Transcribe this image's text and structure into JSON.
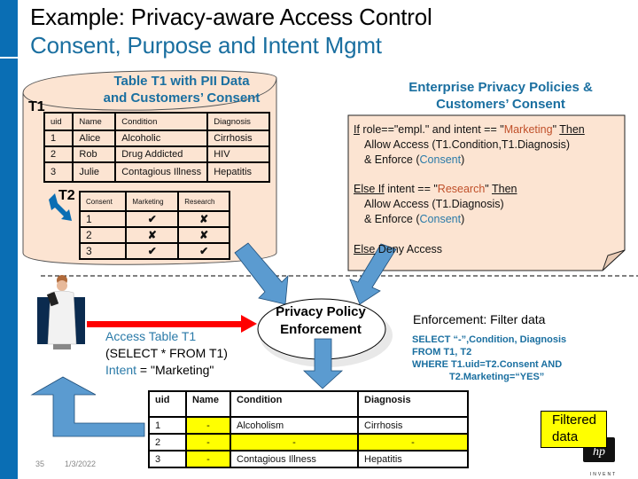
{
  "slide": {
    "title_line1": "Example: Privacy-aware Access Control",
    "title_line2": "Consent, Purpose and Intent Mgmt",
    "page_number": "35",
    "date": "1/3/2022",
    "colors": {
      "accent_blue": "#0a6eb4",
      "title_blue": "#1a6fa0",
      "arrow_blue": "#5b9bd0",
      "cylinder_fill": "#fce4d2",
      "highlight_yellow": "#ffff00",
      "red_arrow": "#ff0000"
    }
  },
  "database": {
    "title_line1": "Table T1 with PII Data",
    "title_line2": "and Customers’ Consent",
    "t1": {
      "label": "T1",
      "headers": [
        "uid",
        "Name",
        "Condition",
        "Diagnosis"
      ],
      "rows": [
        [
          "1",
          "Alice",
          "Alcoholic",
          "Cirrhosis"
        ],
        [
          "2",
          "Rob",
          "Drug Addicted",
          "HIV"
        ],
        [
          "3",
          "Julie",
          "Contagious Illness",
          "Hepatitis"
        ]
      ]
    },
    "t2": {
      "label": "T2",
      "headers": [
        "Consent",
        "Marketing",
        "Research"
      ],
      "rows": [
        {
          "consent": "1",
          "marketing": "yes",
          "research": "no"
        },
        {
          "consent": "2",
          "marketing": "no",
          "research": "no"
        },
        {
          "consent": "3",
          "marketing": "yes",
          "research": "yes"
        }
      ],
      "yes_glyph": "✔",
      "no_glyph": "✘"
    }
  },
  "policies": {
    "title_line1": "Enterprise Privacy Policies &",
    "title_line2": "Customers’ Consent",
    "rule1": {
      "kw_if": "If",
      "cond_pre": " role==\"empl.\" and intent == \"",
      "intent": "Marketing",
      "cond_post": "\" ",
      "kw_then": "Then",
      "action": "Allow Access (T1.Condition,T1.Diagnosis)",
      "enforce_pre": "& Enforce (",
      "enforce_kw": "Consent",
      "enforce_post": ")"
    },
    "rule2": {
      "kw_elseif": "Else If",
      "cond_pre": " intent == \"",
      "intent": "Research",
      "cond_post": "\" ",
      "kw_then": "Then",
      "action": "Allow Access (T1.Diagnosis)",
      "enforce_pre": "& Enforce (",
      "enforce_kw": "Consent",
      "enforce_post": ")"
    },
    "rule3": {
      "kw_else": "Else",
      "action": " Deny Access"
    }
  },
  "request": {
    "line1": "Access Table T1",
    "line2": "(SELECT * FROM T1)",
    "line3_kw": "Intent",
    "line3_rest": " = \"Marketing\""
  },
  "enforcement": {
    "node_line1": "Privacy Policy",
    "node_line2": "Enforcement",
    "title": "Enforcement: Filter data",
    "sql": [
      "SELECT “-”,Condition, Diagnosis",
      "FROM T1, T2",
      "WHERE T1.uid=T2.Consent AND",
      "T2.Marketing=“YES”"
    ]
  },
  "result": {
    "headers": [
      "uid",
      "Name",
      "Condition",
      "Diagnosis"
    ],
    "rows": [
      [
        "1",
        "-",
        "Alcoholism",
        "Cirrhosis"
      ],
      [
        "2",
        "-",
        "-",
        "-"
      ],
      [
        "3",
        "-",
        "Contagious Illness",
        "Hepatitis"
      ]
    ],
    "filtered_label_line1": "Filtered",
    "filtered_label_line2": "data"
  }
}
